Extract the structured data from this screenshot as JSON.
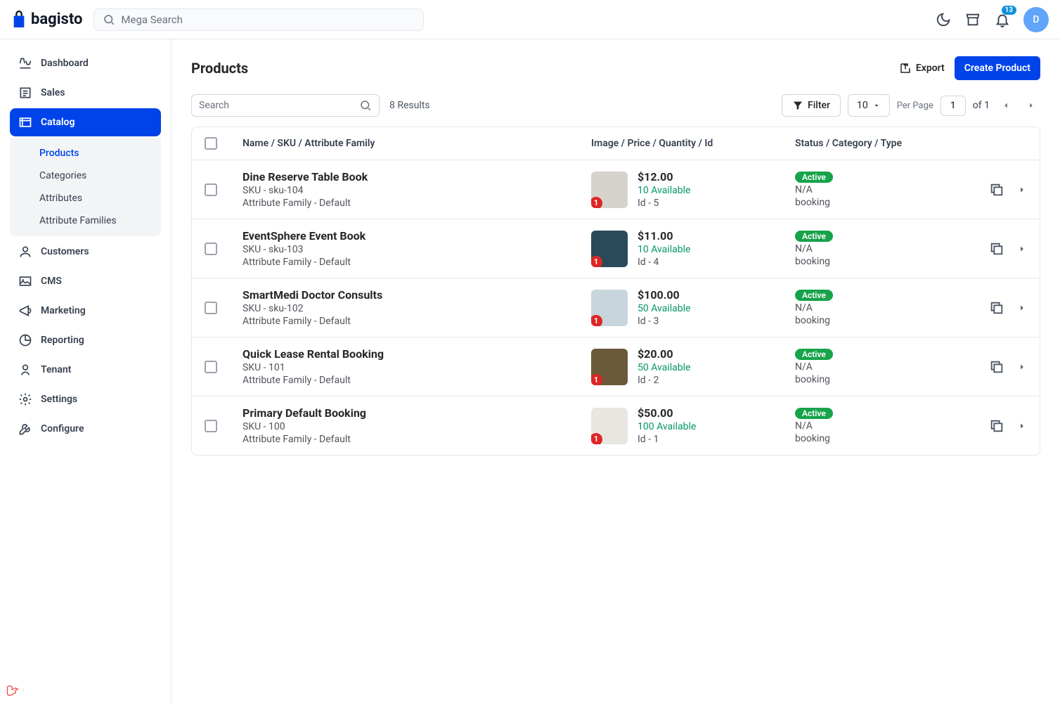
{
  "app_name": "bagisto",
  "search_placeholder": "Mega Search",
  "notification_count": "13",
  "avatar_letter": "D",
  "sidebar": [
    {
      "label": "Dashboard",
      "icon": "dashboard",
      "active": false
    },
    {
      "label": "Sales",
      "icon": "sales",
      "active": false
    },
    {
      "label": "Catalog",
      "icon": "catalog",
      "active": true,
      "children": [
        {
          "label": "Products",
          "active": true
        },
        {
          "label": "Categories",
          "active": false
        },
        {
          "label": "Attributes",
          "active": false
        },
        {
          "label": "Attribute Families",
          "active": false
        }
      ]
    },
    {
      "label": "Customers",
      "icon": "customers",
      "active": false
    },
    {
      "label": "CMS",
      "icon": "cms",
      "active": false
    },
    {
      "label": "Marketing",
      "icon": "marketing",
      "active": false
    },
    {
      "label": "Reporting",
      "icon": "reporting",
      "active": false
    },
    {
      "label": "Tenant",
      "icon": "tenant",
      "active": false
    },
    {
      "label": "Settings",
      "icon": "settings",
      "active": false
    },
    {
      "label": "Configure",
      "icon": "configure",
      "active": false
    }
  ],
  "page_title": "Products",
  "export_label": "Export",
  "create_label": "Create Product",
  "tool_search_placeholder": "Search",
  "results_label": "8 Results",
  "filter_label": "Filter",
  "per_page_value": "10",
  "per_page_label": "Per Page",
  "current_page": "1",
  "of_pages": "of 1",
  "headers": {
    "name": "Name / SKU / Attribute Family",
    "image": "Image / Price / Quantity / Id",
    "status": "Status / Category / Type"
  },
  "products": [
    {
      "name": "Dine Reserve Table Book",
      "sku": "SKU - sku-104",
      "family": "Attribute Family - Default",
      "thumb_count": "1",
      "price": "$12.00",
      "available": "10 Available",
      "id": "Id - 5",
      "status": "Active",
      "category": "N/A",
      "type": "booking",
      "thumb_bg": "#d6d3cd"
    },
    {
      "name": "EventSphere Event Book",
      "sku": "SKU - sku-103",
      "family": "Attribute Family - Default",
      "thumb_count": "1",
      "price": "$11.00",
      "available": "10 Available",
      "id": "Id - 4",
      "status": "Active",
      "category": "N/A",
      "type": "booking",
      "thumb_bg": "#2a4a5a"
    },
    {
      "name": "SmartMedi Doctor Consults",
      "sku": "SKU - sku-102",
      "family": "Attribute Family - Default",
      "thumb_count": "1",
      "price": "$100.00",
      "available": "50 Available",
      "id": "Id - 3",
      "status": "Active",
      "category": "N/A",
      "type": "booking",
      "thumb_bg": "#c9d5dc"
    },
    {
      "name": "Quick Lease Rental Booking",
      "sku": "SKU - 101",
      "family": "Attribute Family - Default",
      "thumb_count": "1",
      "price": "$20.00",
      "available": "50 Available",
      "id": "Id - 2",
      "status": "Active",
      "category": "N/A",
      "type": "booking",
      "thumb_bg": "#6b5a3a"
    },
    {
      "name": "Primary Default Booking",
      "sku": "SKU - 100",
      "family": "Attribute Family - Default",
      "thumb_count": "1",
      "price": "$50.00",
      "available": "100 Available",
      "id": "Id - 1",
      "status": "Active",
      "category": "N/A",
      "type": "booking",
      "thumb_bg": "#e8e6e0"
    }
  ]
}
